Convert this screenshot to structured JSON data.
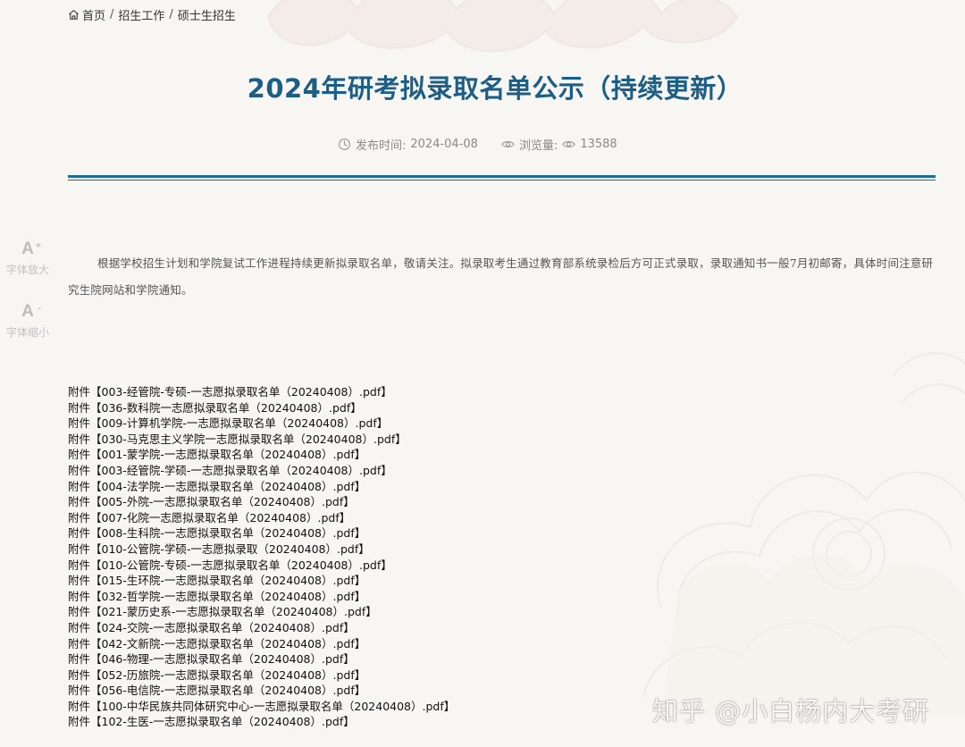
{
  "breadcrumb": {
    "home": "首页",
    "level1": "招生工作",
    "level2": "硕士生招生",
    "separator": "/"
  },
  "article": {
    "title": "2024年研考拟录取名单公示（持续更新）",
    "publish_label": "发布时间:",
    "publish_date": "2024-04-08",
    "views_label": "浏览量:",
    "views_count": "13588",
    "intro": "根据学校招生计划和学院复试工作进程持续更新拟录取名单，敬请关注。拟录取考生通过教育部系统录检后方可正式录取，录取通知书一般7月初邮寄，具体时间注意研究生院网站和学院通知。"
  },
  "font_tools": {
    "increase_glyph": "A",
    "increase_sup": "+",
    "increase_label": "字体放大",
    "decrease_glyph": "A",
    "decrease_sup": "-",
    "decrease_label": "字体缩小"
  },
  "attachments": [
    "附件【003-经管院-专硕-一志愿拟录取名单（20240408）.pdf】",
    "附件【036-数科院一志愿拟录取名单（20240408）.pdf】",
    "附件【009-计算机学院-一志愿拟录取名单（20240408）.pdf】",
    "附件【030-马克思主义学院一志愿拟录取名单（20240408）.pdf】",
    "附件【001-蒙学院-一志愿拟录取名单（20240408）.pdf】",
    "附件【003-经管院-学硕-一志愿拟录取名单（20240408）.pdf】",
    "附件【004-法学院-一志愿拟录取名单（20240408）.pdf】",
    "附件【005-外院-一志愿拟录取名单（20240408）.pdf】",
    "附件【007-化院一志愿拟录取名单（20240408）.pdf】",
    "附件【008-生科院-一志愿拟录取名单（20240408）.pdf】",
    "附件【010-公管院-学硕-一志愿拟录取（20240408）.pdf】",
    "附件【010-公管院-专硕-一志愿拟录取名单（20240408）.pdf】",
    "附件【015-生环院-一志愿拟录取名单（20240408）.pdf】",
    "附件【032-哲学院-一志愿拟录取名单（20240408）.pdf】",
    "附件【021-蒙历史系-一志愿拟录取名单（20240408）.pdf】",
    "附件【024-交院-一志愿拟录取名单（20240408）.pdf】",
    "附件【042-文新院-一志愿拟录取名单（20240408）.pdf】",
    "附件【046-物理-一志愿拟录取名单（20240408）.pdf】",
    "附件【052-历旅院-一志愿拟录取名单（20240408）.pdf】",
    "附件【056-电信院-一志愿拟录取名单（20240408）.pdf】",
    "附件【100-中华民族共同体研究中心-一志愿拟录取名单（20240408）.pdf】",
    "附件【102-生医-一志愿拟录取名单（20240408）.pdf】"
  ],
  "watermark": "知乎 @小白杨内大考研",
  "colors": {
    "title": "#1c5f86",
    "rule": "#1f6b95",
    "background": "#f8f6f2"
  }
}
